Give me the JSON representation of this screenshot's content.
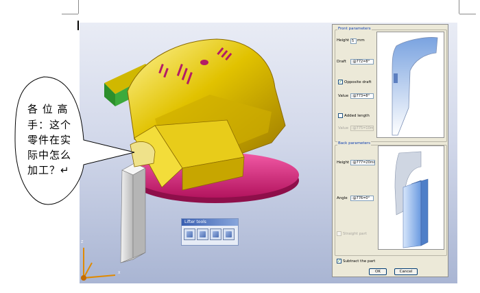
{
  "lifter_toolbar": {
    "title": "Lifter tools"
  },
  "front_parameters": {
    "title": "Front parameters",
    "height_label": "Height",
    "height_value": "5",
    "height_unit": "mm",
    "draft_label": "Draft",
    "draft_value": ":@772=8°",
    "opposite_draft_label": "Opposite draft",
    "opposite_draft_checked": true,
    "value_label": "Value",
    "value_value": ":@773=8°",
    "added_length_label": "Added length",
    "added_length_checked": false,
    "added_value_label": "Value",
    "added_value_value": ":@775=10mm"
  },
  "back_parameters": {
    "title": "Back parameters",
    "height_label": "Height",
    "height_value": ":@777=20mm",
    "angle_label": "Angle",
    "angle_value": ":@776=0°",
    "straight_part_label": "Straight part",
    "straight_part_checked": false
  },
  "subtract_part_label": "Subtract the part",
  "subtract_part_checked": true,
  "ok_label": "OK",
  "cancel_label": "Cancel",
  "bubble": {
    "lines": [
      "各 位 高",
      "手：这个",
      "零件在实",
      "际中怎么",
      "加工？↵"
    ]
  },
  "axis_labels": {
    "z": "Z",
    "x": "X"
  },
  "colors": {
    "part_body": "#e1c200",
    "base_disc": "#e0227a",
    "green_block": "#3caa3c",
    "lifter_bar": "#e6e6e6",
    "viewport_top": "#e9ecf5",
    "viewport_bottom": "#a9b5d3",
    "panel_bg": "#ece9d8",
    "group_title": "#0a3bb0"
  }
}
